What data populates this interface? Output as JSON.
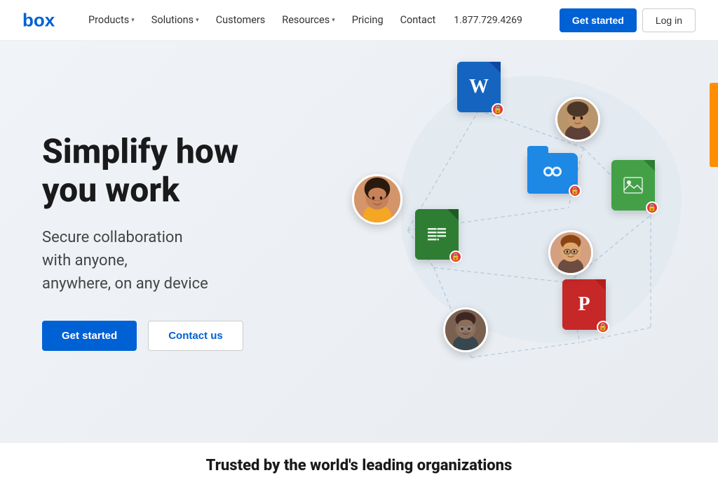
{
  "brand": {
    "logo_text": "box",
    "logo_color": "#0061D5"
  },
  "navbar": {
    "items": [
      {
        "label": "Products",
        "has_dropdown": true
      },
      {
        "label": "Solutions",
        "has_dropdown": true
      },
      {
        "label": "Customers",
        "has_dropdown": false
      },
      {
        "label": "Resources",
        "has_dropdown": true
      },
      {
        "label": "Pricing",
        "has_dropdown": false
      },
      {
        "label": "Contact",
        "has_dropdown": false
      }
    ],
    "phone": "1.877.729.4269",
    "get_started_label": "Get started",
    "login_label": "Log in"
  },
  "hero": {
    "title_line1": "Simplify how",
    "title_line2": "you work",
    "subtitle": "Secure collaboration\nwith anyone,\nanywhere, on any device",
    "cta_primary": "Get started",
    "cta_secondary": "Contact us"
  },
  "trusted": {
    "text": "Trusted by the world's leading organizations"
  },
  "illustration": {
    "files": [
      {
        "type": "word",
        "label": "W"
      },
      {
        "type": "sheets",
        "label": "⊞"
      },
      {
        "type": "powerpoint",
        "label": "P"
      },
      {
        "type": "folder",
        "label": "👥"
      },
      {
        "type": "image",
        "label": "🖼"
      }
    ],
    "avatars": [
      "person-woman",
      "person-man-1",
      "person-man-2",
      "person-man-glasses"
    ]
  }
}
